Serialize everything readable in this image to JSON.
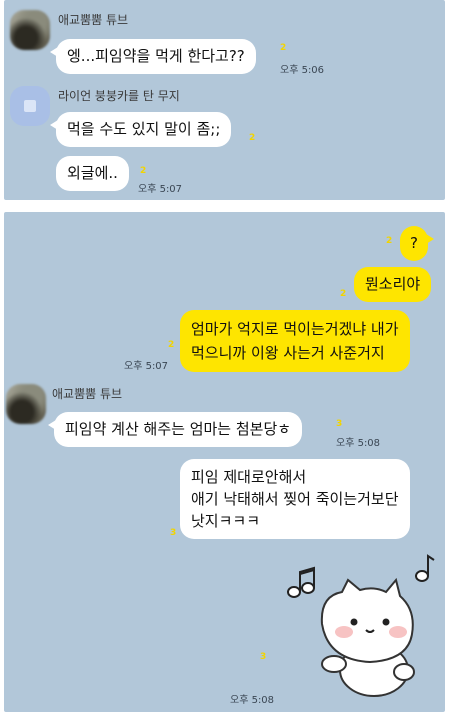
{
  "panel_top": {
    "messages": [
      {
        "sender": "애교뿜뿜 튜브",
        "text": "엥...피임약을 먹게 한다고??",
        "unread": "2",
        "time": "오후 5:06"
      },
      {
        "sender": "라이언 붕붕카를 탄 무지",
        "text": "먹을 수도 있지 말이 좀;;",
        "unread": "2"
      },
      {
        "text": "외글에..",
        "unread": "2",
        "time": "오후 5:07"
      }
    ]
  },
  "panel_bottom": {
    "sent": [
      {
        "text": "?",
        "unread": "2"
      },
      {
        "text": "뭔소리야",
        "unread": "2"
      },
      {
        "line1": "엄마가 억지로 먹이는거겠냐 내가",
        "line2": "먹으니까 이왕 사는거 사준거지",
        "unread": "2",
        "time": "오후 5:07"
      }
    ],
    "received": [
      {
        "sender": "애교뿜뿜 튜브",
        "text": "피임약 계산 해주는 엄마는 첨본당ㅎ",
        "unread": "3",
        "time": "오후 5:08"
      },
      {
        "line1": "피임 제대로안해서",
        "line2": "애기 낙태해서 찢어 죽이는거보단",
        "line3": "낫지ㅋㅋㅋ",
        "unread": "3"
      }
    ],
    "sticker": {
      "name": "white-cat-sticker",
      "unread": "3",
      "time": "오후 5:08"
    }
  },
  "colors": {
    "chat_bg": "#b2c7d9",
    "my_bubble": "#fee500",
    "their_bubble": "#ffffff",
    "unread": "#f2d400"
  }
}
